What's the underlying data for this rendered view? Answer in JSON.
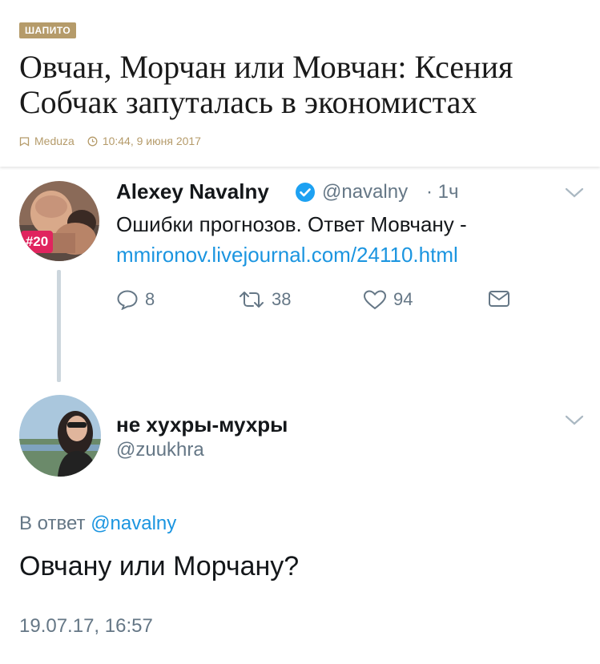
{
  "article": {
    "tag": "ШАПИТО",
    "headline": "Овчан, Морчан или Мовчан: Ксения Собчак запуталась в экономистах",
    "source": "Meduza",
    "datetime": "10:44, 9 июня 2017",
    "accent_color": "#b59b6a"
  },
  "tweet1": {
    "author_name": "Alexey Navalny",
    "handle": "@navalny",
    "time": "· 1ч",
    "avatar_badge": "#20",
    "text_line1": "Ошибки прогнозов. Ответ Мовчану -",
    "link": "mmironov.livejournal.com/24110.html",
    "actions": {
      "replies": "8",
      "retweets": "38",
      "likes": "94"
    },
    "icons": [
      "verified-badge-icon",
      "chevron-down-icon",
      "reply-icon",
      "retweet-icon",
      "like-icon",
      "dm-icon"
    ]
  },
  "tweet2": {
    "author_name": "не хухры-мухры",
    "handle": "@zuukhra",
    "reply_to_prefix": "В ответ",
    "reply_to_handle": "@navalny",
    "text": "Овчану или Морчану?",
    "timestamp": "19.07.17, 16:57"
  },
  "colors": {
    "link": "#1b95e0",
    "secondary_text": "#657786",
    "thread_line": "#ccd6dd",
    "badge_red": "#e0245e"
  }
}
